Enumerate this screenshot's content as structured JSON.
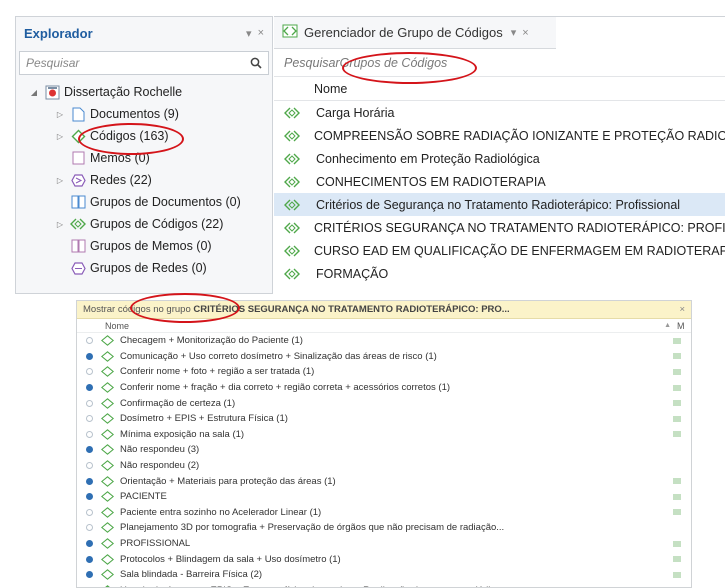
{
  "explorer": {
    "title": "Explorador",
    "controls": [
      "▾",
      "×"
    ],
    "search_placeholder": "Pesquisar",
    "tree": {
      "root": "Dissertação Rochelle",
      "items": [
        {
          "label": "Documentos (9)",
          "icon": "document-icon",
          "expandable": true
        },
        {
          "label": "Códigos (163)",
          "icon": "code-diamond-icon",
          "expandable": true
        },
        {
          "label": "Memos (0)",
          "icon": "memo-icon",
          "expandable": false
        },
        {
          "label": "Redes (22)",
          "icon": "network-icon",
          "expandable": true
        },
        {
          "label": "Grupos de Documentos (0)",
          "icon": "document-group-icon",
          "expandable": false
        },
        {
          "label": "Grupos de Códigos (22)",
          "icon": "code-group-icon",
          "expandable": true
        },
        {
          "label": "Grupos de Memos (0)",
          "icon": "memo-group-icon",
          "expandable": false
        },
        {
          "label": "Grupos de Redes (0)",
          "icon": "network-group-icon",
          "expandable": false
        }
      ]
    }
  },
  "manager": {
    "tab_title": "Gerenciador de Grupo de Códigos",
    "tab_controls": [
      "▾",
      "×"
    ],
    "search_prefix": "Pesquisar",
    "search_placeholder": "Grupos de Códigos",
    "column": "Nome",
    "groups": [
      {
        "label": "Carga Horária",
        "selected": false
      },
      {
        "label": "COMPREENSÃO SOBRE RADIAÇÃO IONIZANTE E PROTEÇÃO RADIOLÓGICA",
        "selected": false
      },
      {
        "label": "Conhecimento em Proteção Radiológica",
        "selected": false
      },
      {
        "label": "CONHECIMENTOS EM RADIOTERAPIA",
        "selected": false
      },
      {
        "label": "Critérios de Segurança no Tratamento Radioterápico: Profissional",
        "selected": true
      },
      {
        "label": "CRITÉRIOS SEGURANÇA NO TRATAMENTO RADIOTERÁPICO: PROFISSIONAL",
        "selected": false
      },
      {
        "label": "CURSO EAD EM QUALIFICAÇÃO DE ENFERMAGEM EM RADIOTERAPIA",
        "selected": false
      },
      {
        "label": "FORMAÇÃO",
        "selected": false
      }
    ]
  },
  "popup": {
    "header_prefix": "Mostrar códigos no grupo",
    "header_group": "CRITÉRIOS SEGURANÇA NO TRATAMENTO RADIOTERÁPICO: PRO...",
    "close": "×",
    "column": "Nome",
    "column_m": "M",
    "codes": [
      {
        "label": "Checagem + Monitorização do Paciente (1)",
        "dot": "empty",
        "mark": true
      },
      {
        "label": "Comunicação + Uso correto dosímetro +  Sinalização das áreas de risco (1)",
        "dot": "filled",
        "mark": true
      },
      {
        "label": "Conferir nome + foto + região a ser tratada (1)",
        "dot": "empty",
        "mark": true
      },
      {
        "label": "Conferir nome + fração + dia correto + região correta + acessórios corretos (1)",
        "dot": "filled",
        "mark": true
      },
      {
        "label": "Confirmação de certeza (1)",
        "dot": "empty",
        "mark": true
      },
      {
        "label": "Dosímetro + EPIS + Estrutura Física (1)",
        "dot": "empty",
        "mark": true
      },
      {
        "label": "Mínima exposição na sala (1)",
        "dot": "empty",
        "mark": true
      },
      {
        "label": "Não respondeu  (3)",
        "dot": "filled",
        "mark": false
      },
      {
        "label": "Não respondeu (2)",
        "dot": "empty",
        "mark": false
      },
      {
        "label": "Orientação + Materiais para proteção das áreas (1)",
        "dot": "filled",
        "mark": true
      },
      {
        "label": "PACIENTE",
        "dot": "filled",
        "mark": true
      },
      {
        "label": "Paciente entra sozinho no Acelerador Linear (1)",
        "dot": "empty",
        "mark": true
      },
      {
        "label": "Planejamento 3D por tomografia + Preservação de órgãos que não precisam de radiação...",
        "dot": "empty",
        "mark": false
      },
      {
        "label": "PROFISSIONAL",
        "dot": "filled",
        "mark": true
      },
      {
        "label": "Protocolos + Blindagem da sala + Uso dosímetro (1)",
        "dot": "filled",
        "mark": true
      },
      {
        "label": "Sala blindada - Barreira Física  (2)",
        "dot": "filled",
        "mark": true
      },
      {
        "label": "Uso de dosímetros + EPIS + Estrutura física do serviço + Realização de exames periódico...",
        "dot": "filled",
        "mark": false
      }
    ]
  },
  "colors": {
    "accent": "#1f5da0",
    "code_green": "#4fa84a",
    "highlight_red": "#d4141a",
    "selection": "#dbe8f6"
  }
}
